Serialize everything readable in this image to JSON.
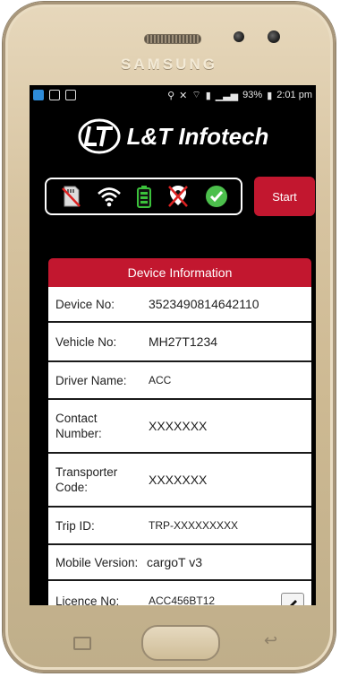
{
  "device": {
    "brand": "SAMSUNG"
  },
  "status_bar": {
    "battery": "93%",
    "time": "2:01 pm"
  },
  "app": {
    "logo_text": "L&T Infotech",
    "status_icons": [
      "memory-card-missing-icon",
      "wifi-icon",
      "battery-icon",
      "location-off-icon",
      "check-icon"
    ],
    "start_label": "Start",
    "accent": "#c2172f"
  },
  "device_info": {
    "title": "Device Information",
    "rows": [
      {
        "label": "Device No:",
        "value": "3523490814642110"
      },
      {
        "label": "Vehicle No:",
        "value": "MH27T1234"
      },
      {
        "label": "Driver Name:",
        "value": "ACC"
      },
      {
        "label": "Contact Number:",
        "value": "XXXXXXX"
      },
      {
        "label": "Transporter Code:",
        "value": "XXXXXXX"
      },
      {
        "label": "Trip ID:",
        "value": "TRP-XXXXXXXXX"
      },
      {
        "label": "Mobile Version:",
        "value": "cargoT v3"
      },
      {
        "label": "Licence No:",
        "value": "ACC456BT12"
      }
    ]
  }
}
